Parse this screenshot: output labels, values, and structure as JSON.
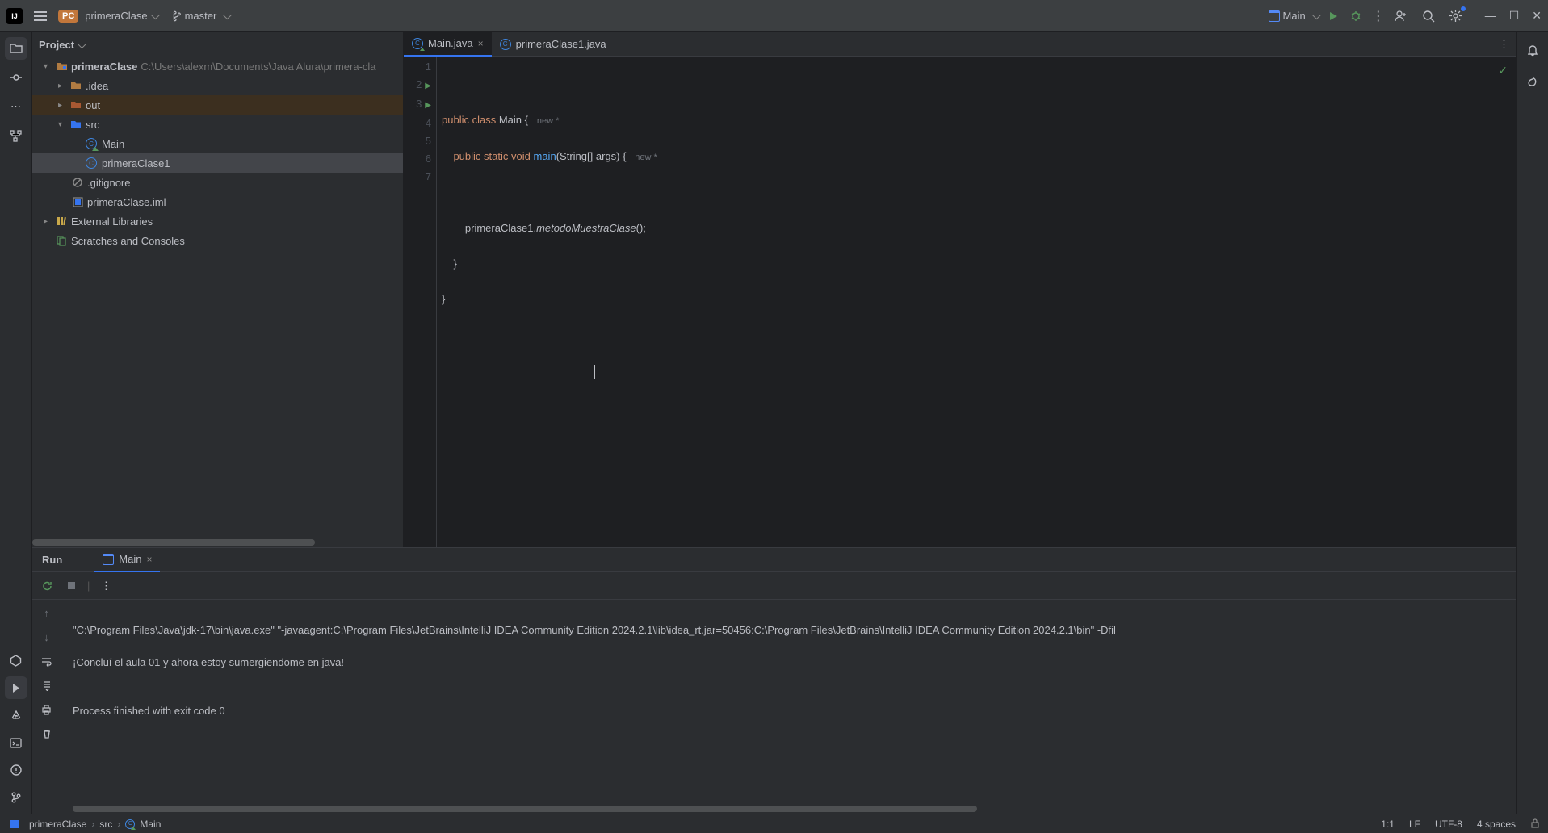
{
  "titlebar": {
    "logo_text": "IJ",
    "project_badge": "PC",
    "project_name": "primeraClase",
    "vcs_branch": "master",
    "run_config_name": "Main"
  },
  "project_panel": {
    "header": "Project",
    "root_name": "primeraClase",
    "root_path": "C:\\Users\\alexm\\Documents\\Java Alura\\primera-cla",
    "items": {
      "idea": ".idea",
      "out": "out",
      "src": "src",
      "main": "Main",
      "primeraClase1": "primeraClase1",
      "gitignore": ".gitignore",
      "iml": "primeraClase.iml",
      "ext_lib": "External Libraries",
      "scratches": "Scratches and Consoles"
    }
  },
  "tabs": {
    "main": "Main.java",
    "clase1": "primeraClase1.java"
  },
  "editor": {
    "line_numbers": [
      "1",
      "2",
      "3",
      "4",
      "5",
      "6",
      "7"
    ],
    "hint_new": "new *",
    "tokens": {
      "public": "public",
      "class": "class",
      "Main": "Main",
      "static": "static",
      "void": "void",
      "main": "main",
      "String": "String",
      "args": "args",
      "primeraClase1": "primeraClase1",
      "metodo": "metodoMuestraClase"
    }
  },
  "run": {
    "label": "Run",
    "tab_name": "Main",
    "console_line1": "\"C:\\Program Files\\Java\\jdk-17\\bin\\java.exe\" \"-javaagent:C:\\Program Files\\JetBrains\\IntelliJ IDEA Community Edition 2024.2.1\\lib\\idea_rt.jar=50456:C:\\Program Files\\JetBrains\\IntelliJ IDEA Community Edition 2024.2.1\\bin\" -Dfil",
    "console_line2": "¡Concluí el aula 01 y ahora estoy sumergiendome en java!",
    "console_line3": "",
    "console_line4": "Process finished with exit code 0"
  },
  "breadcrumb": {
    "root": "primeraClase",
    "src": "src",
    "main": "Main"
  },
  "status": {
    "pos": "1:1",
    "eol": "LF",
    "encoding": "UTF-8",
    "indent": "4 spaces"
  }
}
